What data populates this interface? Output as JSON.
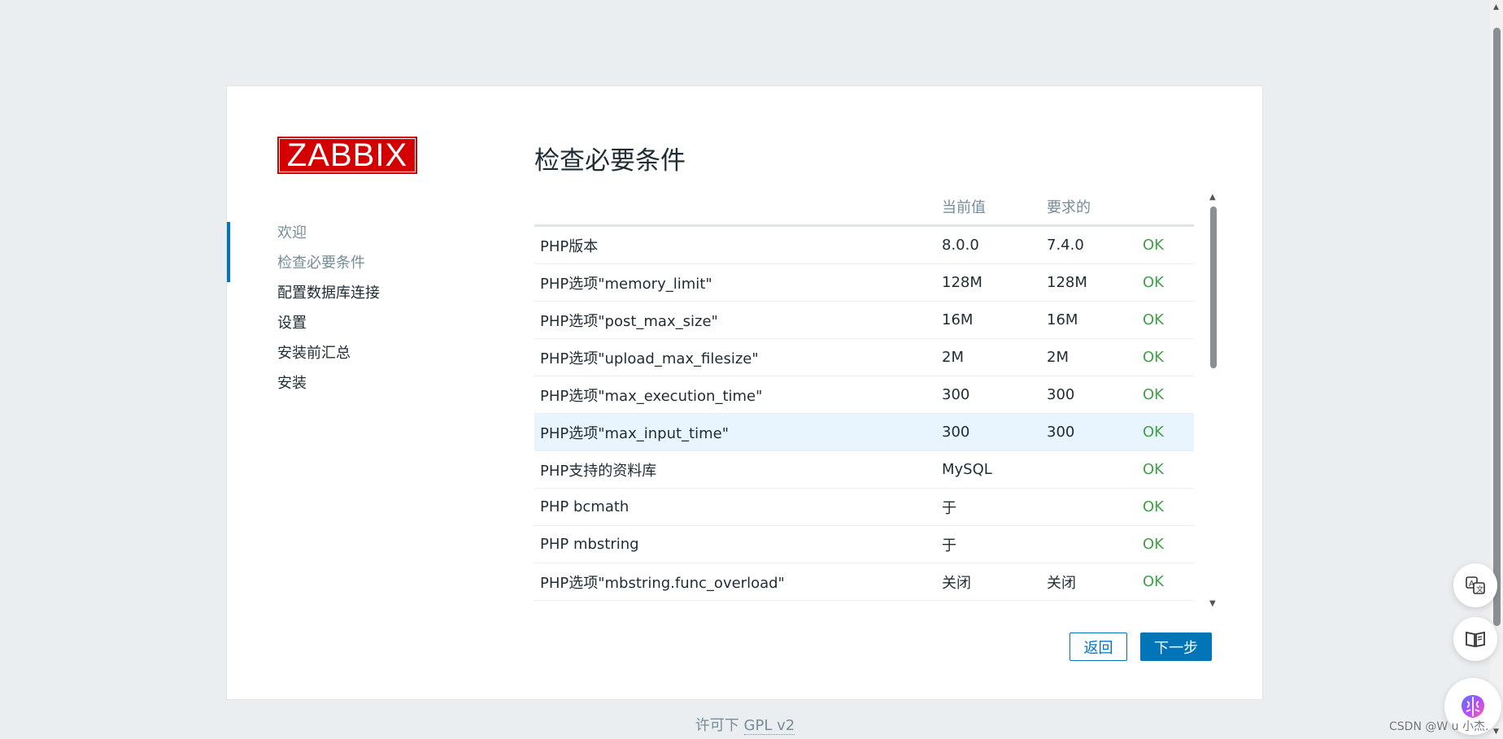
{
  "logo": {
    "text": "ZABBIX"
  },
  "sidebar": {
    "steps": [
      {
        "label": "欢迎",
        "state": "done"
      },
      {
        "label": "检查必要条件",
        "state": "current"
      },
      {
        "label": "配置数据库连接",
        "state": "pending"
      },
      {
        "label": "设置",
        "state": "pending"
      },
      {
        "label": "安装前汇总",
        "state": "pending"
      },
      {
        "label": "安装",
        "state": "pending"
      }
    ]
  },
  "main": {
    "title": "检查必要条件",
    "table": {
      "headers": [
        "",
        "当前值",
        "要求的",
        ""
      ],
      "rows": [
        {
          "name": "PHP版本",
          "current": "8.0.0",
          "required": "7.4.0",
          "status": "OK"
        },
        {
          "name": "PHP选项\"memory_limit\"",
          "current": "128M",
          "required": "128M",
          "status": "OK"
        },
        {
          "name": "PHP选项\"post_max_size\"",
          "current": "16M",
          "required": "16M",
          "status": "OK"
        },
        {
          "name": "PHP选项\"upload_max_filesize\"",
          "current": "2M",
          "required": "2M",
          "status": "OK"
        },
        {
          "name": "PHP选项\"max_execution_time\"",
          "current": "300",
          "required": "300",
          "status": "OK"
        },
        {
          "name": "PHP选项\"max_input_time\"",
          "current": "300",
          "required": "300",
          "status": "OK"
        },
        {
          "name": "PHP支持的资料库",
          "current": "MySQL",
          "required": "",
          "status": "OK"
        },
        {
          "name": "PHP bcmath",
          "current": "于",
          "required": "",
          "status": "OK"
        },
        {
          "name": "PHP mbstring",
          "current": "于",
          "required": "",
          "status": "OK"
        },
        {
          "name": "PHP选项\"mbstring.func_overload\"",
          "current": "关闭",
          "required": "关闭",
          "status": "OK"
        }
      ]
    },
    "buttons": {
      "back": "返回",
      "next": "下一步"
    }
  },
  "footer": {
    "prefix": "许可下",
    "link": "GPL v2"
  },
  "watermark": "CSDN @W u 小杰.",
  "floating": {
    "translate_icon": "translate-icon",
    "reader_icon": "reader-icon",
    "brain_icon": "brain-icon"
  },
  "colors": {
    "brand": "#d40000",
    "accent": "#0275b8",
    "ok": "#429e47",
    "highlight_row": "#e8f5ff"
  }
}
